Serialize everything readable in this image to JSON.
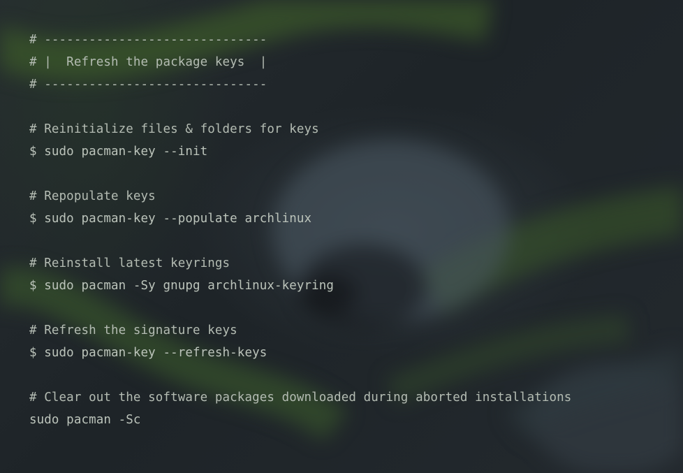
{
  "terminal": {
    "lines": [
      "# ------------------------------",
      "# |  Refresh the package keys  |",
      "# ------------------------------",
      "",
      "# Reinitialize files & folders for keys",
      "$ sudo pacman-key --init",
      "",
      "# Repopulate keys",
      "$ sudo pacman-key --populate archlinux",
      "",
      "# Reinstall latest keyrings",
      "$ sudo pacman -Sy gnupg archlinux-keyring",
      "",
      "# Refresh the signature keys",
      "$ sudo pacman-key --refresh-keys",
      "",
      "# Clear out the software packages downloaded during aborted installations",
      "sudo pacman -Sc"
    ]
  },
  "colors": {
    "background": "#1f252b",
    "text": "#b7bfb6",
    "accent_green": "#3f5a2c"
  }
}
